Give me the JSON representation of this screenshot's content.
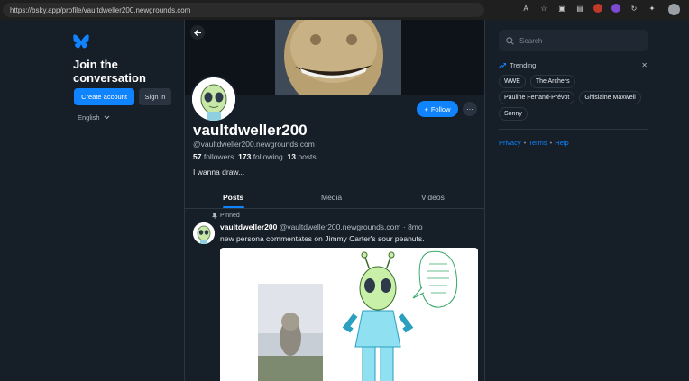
{
  "browser": {
    "url": "https://bsky.app/profile/vaultdweller200.newgrounds.com"
  },
  "left": {
    "join_line1": "Join the",
    "join_line2": "conversation",
    "create_account": "Create account",
    "sign_in": "Sign in",
    "language": "English"
  },
  "profile": {
    "display_name": "vaultdweller200",
    "handle": "@vaultdweller200.newgrounds.com",
    "followers_count": "57",
    "followers_label": "followers",
    "following_count": "173",
    "following_label": "following",
    "posts_count": "13",
    "posts_label": "posts",
    "bio": "I wanna draw...",
    "follow_label": "Follow",
    "more_label": "···"
  },
  "tabs": [
    "Posts",
    "Media",
    "Videos"
  ],
  "post": {
    "pinned_label": "Pinned",
    "author": "vaultdweller200",
    "handle": "@vaultdweller200.newgrounds.com",
    "dot": "·",
    "age": "8mo",
    "text": "new persona commentates on Jimmy Carter's sour peanuts."
  },
  "right": {
    "search_placeholder": "Search",
    "trending_label": "Trending",
    "trending": [
      "WWE",
      "The Archers",
      "Pauline Ferrand-Prévot",
      "Ghislaine Maxwell",
      "Sonny"
    ],
    "links": [
      "Privacy",
      "Terms",
      "Help"
    ],
    "link_sep": "•"
  },
  "colors": {
    "background": "#161e27",
    "accent": "#1083fe",
    "border": "#2c3642",
    "muted": "#aeb8c4"
  }
}
